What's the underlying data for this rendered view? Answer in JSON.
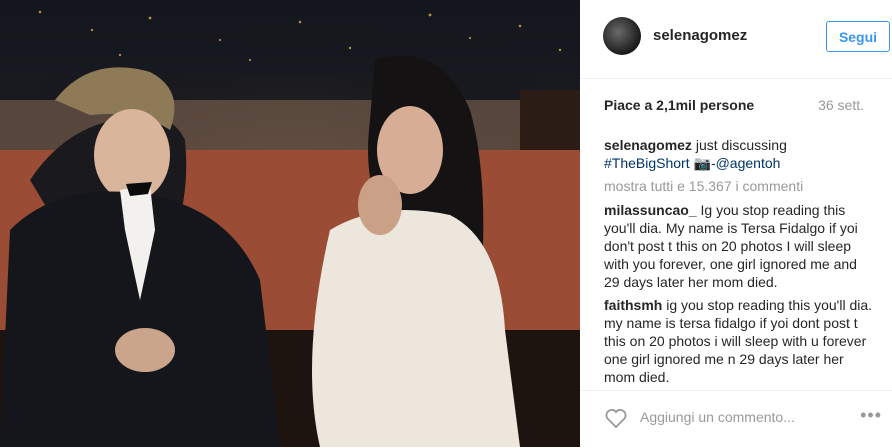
{
  "post": {
    "username": "selenagomez",
    "follow_label": "Segui",
    "likes": "Piace a 2,1mil persone",
    "time": "36 sett.",
    "caption": {
      "user": "selenagomez",
      "text": "just discussing",
      "hashtag": "#TheBigShort",
      "camera_glyph": "📷",
      "mention": "-@agentoh"
    },
    "show_all": "mostra tutti e 15.367 i commenti",
    "comments": [
      {
        "user": "milassuncao_",
        "text": "Ig you stop reading this you'll dia. My name is Tersa Fidalgo if yoi don't post t this on 20 photos I will sleep with you forever, one girl ignored me and 29 days later her mom died."
      },
      {
        "user": "faithsmh",
        "text": "ig you stop reading this you'll dia. my name is tersa fidalgo if yoi dont post t this on 20 photos i will sleep with u forever one girl ignored me n 29 days later her mom died."
      }
    ],
    "add_comment_placeholder": "Aggiungi un commento...",
    "more_glyph": "•••"
  },
  "icons": {
    "heart": "heart-outline-icon",
    "more": "more-options-icon",
    "avatar": "avatar"
  },
  "colors": {
    "link_blue": "#3897f0",
    "hashtag": "#003569",
    "muted": "#999999",
    "text": "#262626"
  }
}
